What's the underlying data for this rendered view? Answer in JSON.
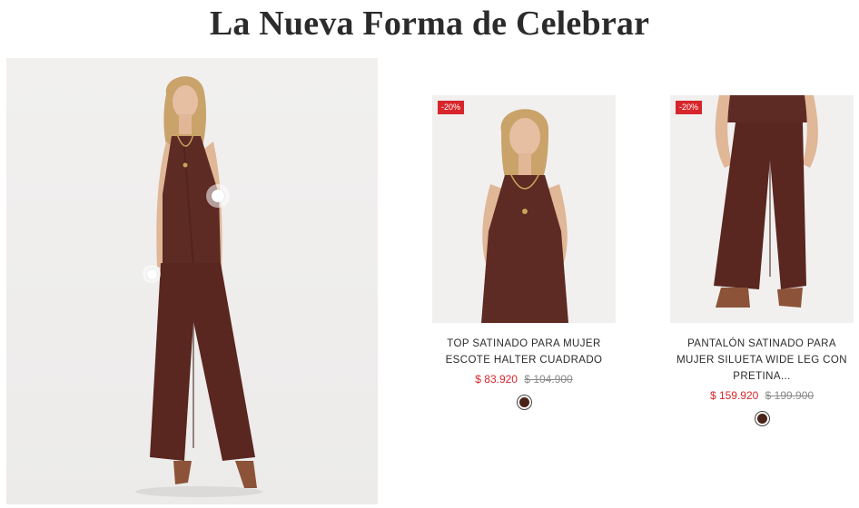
{
  "section": {
    "title": "La Nueva Forma de Celebrar"
  },
  "colors": {
    "fabric": "#5e2a24",
    "sale": "#d7262b",
    "swatch": "#4a2418"
  },
  "hero": {
    "hotspot_count": 2
  },
  "products": [
    {
      "badge": "-20%",
      "name": "TOP SATINADO PARA MUJER ESCOTE HALTER CUADRADO",
      "sale_price": "$ 83.920",
      "old_price": "$ 104.900",
      "swatch_color": "#4a2418"
    },
    {
      "badge": "-20%",
      "name": "PANTALÓN SATINADO PARA MUJER SILUETA WIDE LEG CON PRETINA...",
      "sale_price": "$ 159.920",
      "old_price": "$ 199.900",
      "swatch_color": "#4a2418"
    }
  ]
}
